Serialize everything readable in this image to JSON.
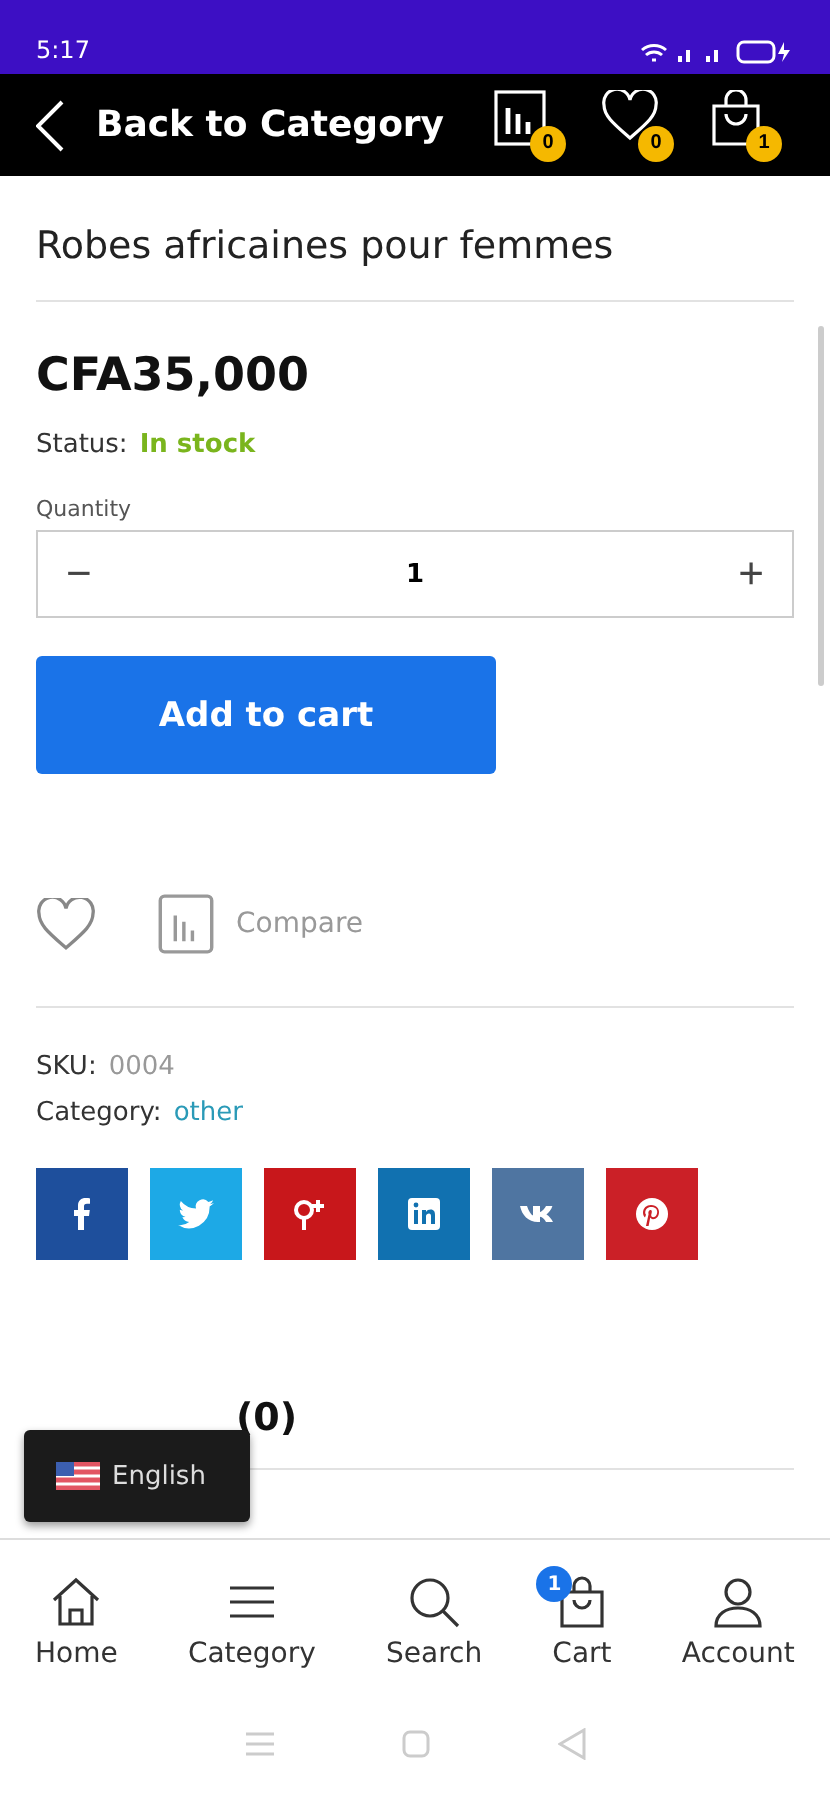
{
  "status_bar": {
    "time": "5:17"
  },
  "header": {
    "back_label": "Back to Category",
    "badges": [
      {
        "kind": "compare",
        "count": "0"
      },
      {
        "kind": "wishlist",
        "count": "0"
      },
      {
        "kind": "cart",
        "count": "1"
      }
    ]
  },
  "product": {
    "title": "Robes africaines pour femmes",
    "price": "CFA35,000",
    "status_label": "Status:",
    "status_value": "In stock",
    "quantity_label": "Quantity",
    "quantity": "1",
    "minus": "−",
    "plus": "+",
    "add_to_cart": "Add to cart",
    "compare_label": "Compare",
    "sku_label": "SKU:",
    "sku_value": "0004",
    "category_label": "Category:",
    "category_value": "other"
  },
  "share": [
    {
      "kind": "facebook",
      "color": "#1e4f9c"
    },
    {
      "kind": "twitter",
      "color": "#1da9e6"
    },
    {
      "kind": "googleplus",
      "color": "#c8171b"
    },
    {
      "kind": "linkedin",
      "color": "#1171b0"
    },
    {
      "kind": "vk",
      "color": "#4f75a1"
    },
    {
      "kind": "pinterest",
      "color": "#cb2027"
    }
  ],
  "reviews_heading": "(0)",
  "language": {
    "label": "English"
  },
  "bottom_nav": [
    {
      "kind": "home",
      "label": "Home"
    },
    {
      "kind": "category",
      "label": "Category"
    },
    {
      "kind": "search",
      "label": "Search"
    },
    {
      "kind": "cart",
      "label": "Cart",
      "badge": "1"
    },
    {
      "kind": "account",
      "label": "Account"
    }
  ]
}
